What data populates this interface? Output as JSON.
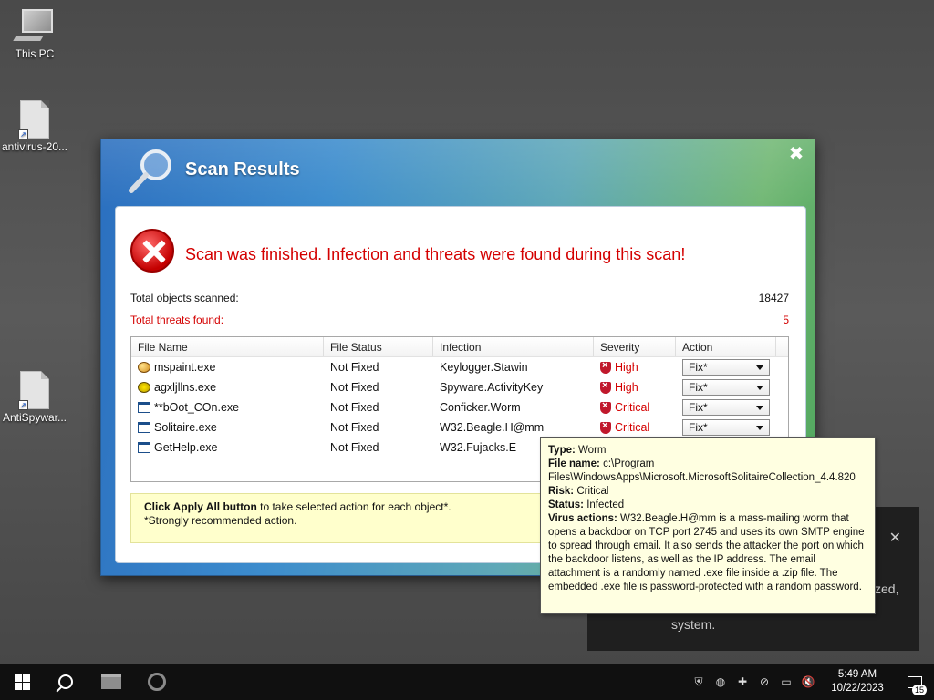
{
  "desktop": {
    "icons": [
      {
        "label": "This PC"
      },
      {
        "label": "antivirus-20..."
      },
      {
        "label": "AntiSpywar..."
      }
    ]
  },
  "dialog": {
    "title": "Scan Results",
    "close_symbol": "✖",
    "headline": "Scan was finished. Infection and threats were found during this scan!",
    "total_scanned_label": "Total objects scanned:",
    "total_scanned_value": "18427",
    "total_threats_label": "Total threats found:",
    "total_threats_value": "5",
    "table": {
      "columns": [
        "File Name",
        "File Status",
        "Infection",
        "Severity",
        "Action"
      ],
      "rows": [
        {
          "file": "mspaint.exe",
          "icon": "paint-icon",
          "status": "Not Fixed",
          "infection": "Keylogger.Stawin",
          "severity": "High",
          "action": "Fix*"
        },
        {
          "file": "agxljllns.exe",
          "icon": "biohazard-icon",
          "status": "Not Fixed",
          "infection": "Spyware.ActivityKey",
          "severity": "High",
          "action": "Fix*"
        },
        {
          "file": "**bOot_COn.exe",
          "icon": "app-window-icon",
          "status": "Not Fixed",
          "infection": "Conficker.Worm",
          "severity": "Critical",
          "action": "Fix*"
        },
        {
          "file": "Solitaire.exe",
          "icon": "app-window-icon",
          "status": "Not Fixed",
          "infection": "W32.Beagle.H@mm",
          "severity": "Critical",
          "action": "Fix*"
        },
        {
          "file": "GetHelp.exe",
          "icon": "app-window-icon",
          "status": "Not Fixed",
          "infection": "W32.Fujacks.E",
          "severity": "",
          "action": ""
        }
      ]
    },
    "notice": {
      "bold": "Click Apply All button",
      "text": " to take selected action for each object*.",
      "note": "*Strongly recommended action."
    }
  },
  "tooltip": {
    "type_label": "Type:",
    "type_value": "Worm",
    "file_label": "File name:",
    "file_value_1": "c:\\Program",
    "file_value_2": "Files\\WindowsApps\\Microsoft.MicrosoftSolitaireCollection_4.4.820",
    "risk_label": "Risk:",
    "risk_value": "Critical",
    "status_label": "Status:",
    "status_value": "Infected",
    "actions_label": "Virus actions:",
    "actions_value": "W32.Beagle.H@mm is a mass-mailing worm that opens a backdoor on TCP port 2745 and uses its own SMTP engine to spread through email. It also sends the attacker the port on which the backdoor listens, as well as the IP address. The email attachment is a randomly named .exe file inside a .zip file. The embedded .exe file is password-protected with a random password."
  },
  "toast": {
    "close_symbol": "✕",
    "line1": "zed,",
    "line2": "system."
  },
  "taskbar": {
    "time": "5:49 AM",
    "date": "10/22/2023",
    "notification_count": "15"
  },
  "colors": {
    "danger": "#d40000",
    "tooltip_bg": "#ffffe1",
    "notice_bg": "#ffffcc",
    "taskbar_bg": "#101010"
  }
}
